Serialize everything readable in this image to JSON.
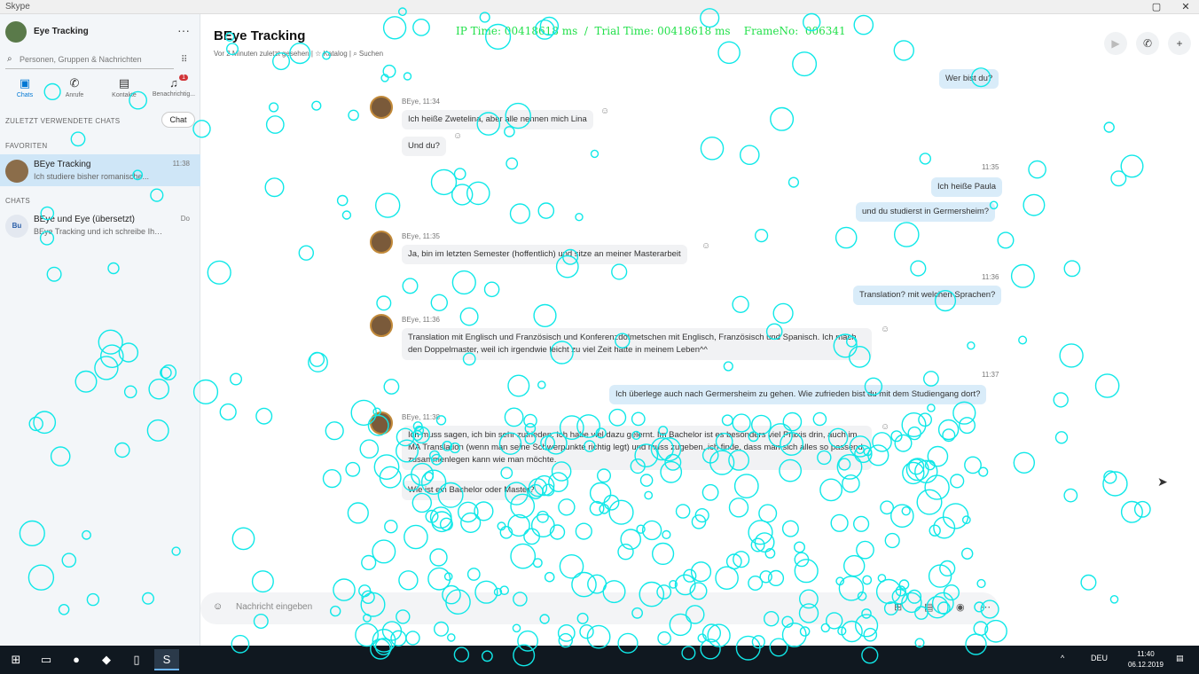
{
  "window": {
    "app_title": "Skype",
    "controls": [
      "▢",
      "✕"
    ]
  },
  "profile": {
    "name": "Eye Tracking",
    "more": "···"
  },
  "search": {
    "placeholder": "Personen, Gruppen & Nachrichten"
  },
  "nav": [
    {
      "label": "Chats",
      "icon": "chat-icon"
    },
    {
      "label": "Anrufe",
      "icon": "phone-icon"
    },
    {
      "label": "Kontakte",
      "icon": "contacts-icon"
    },
    {
      "label": "Benachrichtig...",
      "icon": "bell-icon",
      "badge": "1"
    }
  ],
  "sections": {
    "recent": "ZULETZT VERWENDETE CHATS",
    "favorites": "FAVORITEN",
    "chats": "CHATS"
  },
  "chat_button": "Chat",
  "chat_list": [
    {
      "title": "BEye Tracking",
      "snippet": "Ich studiere bisher romanische...",
      "time": "11:38",
      "initials": ""
    },
    {
      "title": "BEye und Eye (übersetzt)",
      "snippet": "BEye Tracking und ich schreibe Ihnen...",
      "time": "Do",
      "initials": "Bu"
    }
  ],
  "conversation": {
    "title": "BEye Tracking",
    "subtitle": "Vor 2 Minuten zuletzt gesehen | ☆ Katalog | ⌕ Suchen",
    "overlay": "IP Time: 00418618 ms  /  Trial Time: 00418618 ms    FrameNo:  006341",
    "messages": [
      {
        "dir": "out",
        "text": "Wer bist du?"
      },
      {
        "dir": "in",
        "sender": "BEye, 11:34",
        "text": "Ich heiße Zwetelina, aber alle nennen mich Lina"
      },
      {
        "dir": "in",
        "text": "Und du?"
      },
      {
        "dir": "ts",
        "text": "11:35"
      },
      {
        "dir": "out",
        "text": "Ich heiße Paula"
      },
      {
        "dir": "out",
        "text": "und du studierst in Germersheim?"
      },
      {
        "dir": "in",
        "sender": "BEye, 11:35",
        "text": "Ja, bin im letzten Semester (hoffentlich) und sitze an meiner Masterarbeit"
      },
      {
        "dir": "ts",
        "text": "11:36"
      },
      {
        "dir": "out",
        "text": "Translation? mit welchen Sprachen?"
      },
      {
        "dir": "in",
        "sender": "BEye, 11:36",
        "text": "Translation mit Englisch und Französisch und Konferenzdolmetschen mit Englisch, Französisch und Spanisch. Ich mach den Doppelmaster, weil ich irgendwie leicht zu viel Zeit hatte in meinem Leben^^"
      },
      {
        "dir": "ts",
        "text": "11:37"
      },
      {
        "dir": "out",
        "text": "Ich überlege auch nach Germersheim zu gehen. Wie zufrieden bist du mit dem Studiengang dort?"
      },
      {
        "dir": "in",
        "sender": "BEye, 11:38",
        "text": "Ich muss sagen, ich bin sehr zufrieden. Ich habe viel dazu gelernt. Im Bachelor ist es besonders viel Praxis drin, auch im MA Translation (wenn man seine Schwerpunkte richtig legt) und muss zugeben, ich finde, dass man sich alles so passend zusammenlegen kann wie man möchte."
      },
      {
        "dir": "in",
        "text": "Wie ist ein Bachelor oder Master?"
      }
    ]
  },
  "composer": {
    "placeholder": "Nachricht eingeben"
  },
  "taskbar": {
    "time": "11:40",
    "date": "06.12.2019",
    "lang": "DEU"
  }
}
